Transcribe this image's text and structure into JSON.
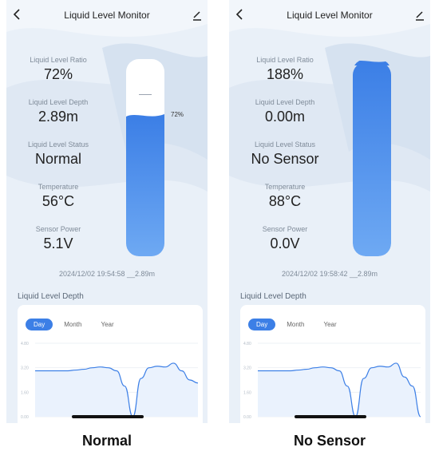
{
  "accent": "#3c7fe6",
  "screens": [
    {
      "title": "Liquid Level Monitor",
      "metrics": [
        {
          "label": "Liquid Level Ratio",
          "value": "72%"
        },
        {
          "label": "Liquid Level Depth",
          "value": "2.89m"
        },
        {
          "label": "Liquid Level Status",
          "value": "Normal"
        },
        {
          "label": "Temperature",
          "value": "56°C"
        },
        {
          "label": "Sensor Power",
          "value": "5.1V"
        }
      ],
      "tank_fill_fraction": 0.72,
      "tank_label": "72%",
      "timestamp": "2024/12/02 19:54:58 __2.89m",
      "chart_title": "Liquid Level Depth",
      "tabs": [
        "Day",
        "Month",
        "Year"
      ],
      "active_tab": "Day",
      "chart_data": {
        "type": "line",
        "yticks": [
          "4.80",
          "3.20",
          "1.60",
          "0.00"
        ],
        "ylim": [
          0,
          4.8
        ],
        "y": [
          3.0,
          3.0,
          3.0,
          3.0,
          3.0,
          3.05,
          3.1,
          3.2,
          3.25,
          3.2,
          3.0,
          2.0,
          0.0,
          2.5,
          3.2,
          3.3,
          3.25,
          3.5,
          3.0,
          2.4,
          2.2
        ]
      },
      "caption": "Normal"
    },
    {
      "title": "Liquid Level Monitor",
      "metrics": [
        {
          "label": "Liquid Level Ratio",
          "value": "188%"
        },
        {
          "label": "Liquid Level Depth",
          "value": "0.00m"
        },
        {
          "label": "Liquid Level Status",
          "value": "No Sensor"
        },
        {
          "label": "Temperature",
          "value": "88°C"
        },
        {
          "label": "Sensor Power",
          "value": "0.0V"
        }
      ],
      "tank_fill_fraction": 1.0,
      "tank_label": "",
      "timestamp": "2024/12/02 19:58:42 __2.89m",
      "chart_title": "Liquid Level Depth",
      "tabs": [
        "Day",
        "Month",
        "Year"
      ],
      "active_tab": "Day",
      "chart_data": {
        "type": "line",
        "yticks": [
          "4.80",
          "3.20",
          "1.60",
          "0.00"
        ],
        "ylim": [
          0,
          4.8
        ],
        "y": [
          3.0,
          3.0,
          3.0,
          3.0,
          3.0,
          3.05,
          3.1,
          3.2,
          3.25,
          3.2,
          3.0,
          2.0,
          0.0,
          2.5,
          3.2,
          3.3,
          3.25,
          3.5,
          2.6,
          2.0,
          0.0
        ]
      },
      "caption": "No Sensor"
    }
  ]
}
